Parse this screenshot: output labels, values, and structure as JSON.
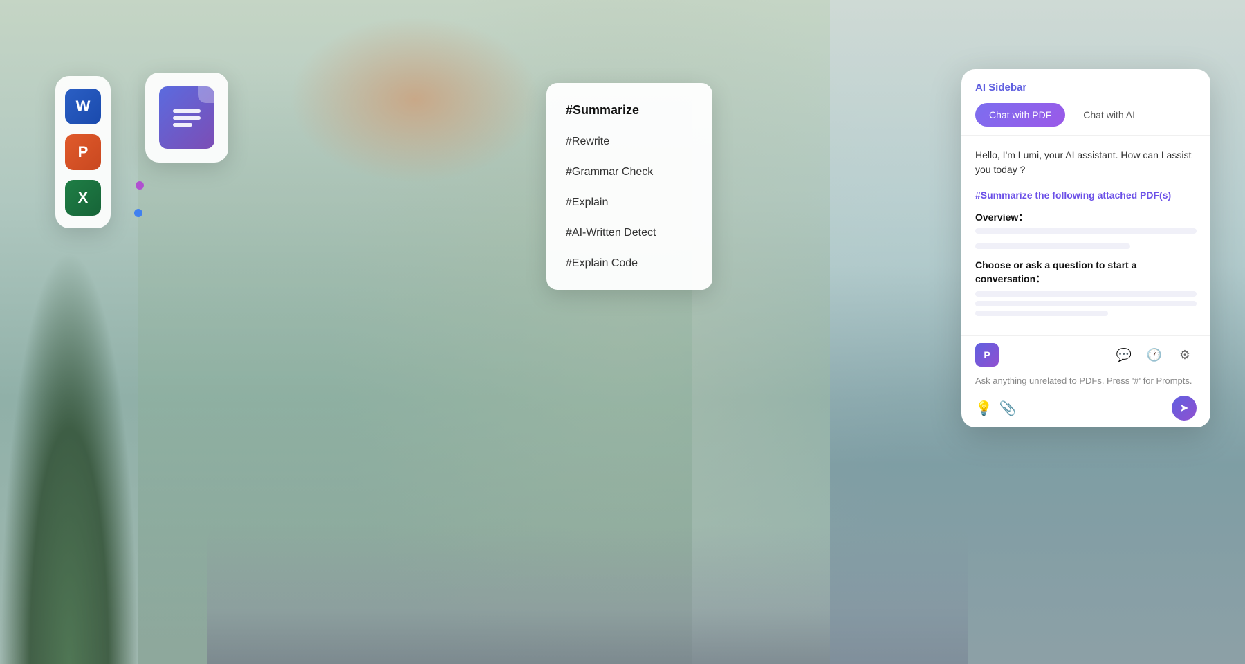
{
  "background": {
    "description": "woman in light green blazer working on laptop in office setting"
  },
  "file_icons_panel": {
    "icons": [
      {
        "id": "word",
        "label": "W",
        "type": "word"
      },
      {
        "id": "powerpoint",
        "label": "P",
        "type": "powerpoint"
      },
      {
        "id": "excel",
        "label": "X",
        "type": "excel"
      }
    ]
  },
  "pdf_panel": {
    "description": "PDF tool icon"
  },
  "hashtag_menu": {
    "items": [
      {
        "id": "summarize",
        "label": "#Summarize",
        "active": true
      },
      {
        "id": "rewrite",
        "label": "#Rewrite",
        "active": false
      },
      {
        "id": "grammar-check",
        "label": "#Grammar Check",
        "active": false
      },
      {
        "id": "explain",
        "label": "#Explain",
        "active": false
      },
      {
        "id": "ai-written-detect",
        "label": "#AI-Written Detect",
        "active": false
      },
      {
        "id": "explain-code",
        "label": "#Explain Code",
        "active": false
      }
    ]
  },
  "ai_sidebar": {
    "title": "AI Sidebar",
    "tabs": [
      {
        "id": "chat-pdf",
        "label": "Chat with PDF",
        "active": true
      },
      {
        "id": "chat-ai",
        "label": "Chat with AI",
        "active": false
      }
    ],
    "greeting": "Hello, I'm Lumi, your AI assistant. How can I assist you today ?",
    "summarize_link": "#Summarize the following attached PDF(s)",
    "overview_section": {
      "label": "Overview：",
      "bars": [
        {
          "width": "100%"
        },
        {
          "width": "65%"
        }
      ]
    },
    "question_section": {
      "label": "Choose or ask a question to start a conversation：",
      "bars": [
        {
          "width": "100%"
        },
        {
          "width": "100%"
        },
        {
          "width": "60%"
        }
      ]
    },
    "input_hint": "Ask anything unrelated to PDFs. Press '#' for Prompts.",
    "toolbar_icons": [
      {
        "id": "pdf-upload",
        "symbol": "P",
        "type": "pdf-btn"
      },
      {
        "id": "chat-bubble",
        "symbol": "💬"
      },
      {
        "id": "clock",
        "symbol": "🕐"
      },
      {
        "id": "settings",
        "symbol": "⚙"
      }
    ],
    "bottom_icons": [
      {
        "id": "lightbulb",
        "symbol": "💡"
      },
      {
        "id": "paperclip",
        "symbol": "📎"
      }
    ],
    "send_symbol": "➤"
  }
}
